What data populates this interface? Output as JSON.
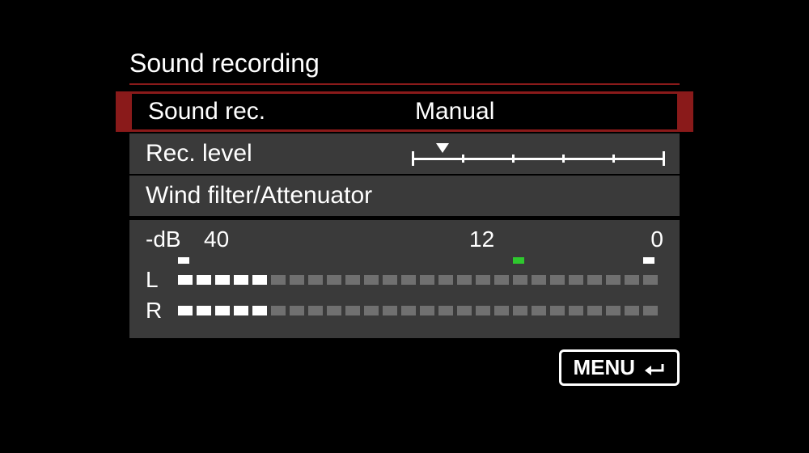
{
  "title": "Sound recording",
  "rows": {
    "sound_rec": {
      "label": "Sound rec.",
      "value": "Manual"
    },
    "rec_level": {
      "label": "Rec. level",
      "slider_position": 0.12,
      "ticks": 6
    },
    "wind_filter": {
      "label": "Wind filter/Attenuator"
    }
  },
  "meter": {
    "scale_label": "-dB",
    "scale_40": "40",
    "scale_12": "12",
    "scale_0": "0",
    "total_segments": 26,
    "channels": {
      "left": {
        "label": "L",
        "active_segments": 5
      },
      "right": {
        "label": "R",
        "active_segments": 5
      }
    },
    "peaks": [
      {
        "position": 0,
        "color": "white"
      },
      {
        "position": 18,
        "color": "green"
      },
      {
        "position": 25,
        "color": "white"
      }
    ]
  },
  "menu_button": {
    "label": "MENU"
  }
}
